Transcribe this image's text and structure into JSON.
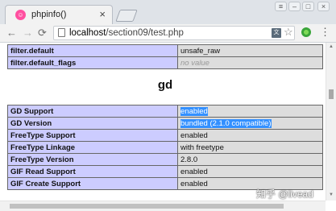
{
  "browser": {
    "tab_title": "phpinfo()",
    "tab_close": "×",
    "favicon_glyph": "☺",
    "window_controls": [
      "≡",
      "–",
      "□",
      "×"
    ],
    "back": "←",
    "forward": "→",
    "reload": "⟳",
    "url_host": "localhost",
    "url_path": "/section09/test.php",
    "translate_glyph": "文",
    "star": "☆",
    "menu": "⋮"
  },
  "page": {
    "top_rows": [
      {
        "directive": "filter.default",
        "value": "unsafe_raw"
      },
      {
        "directive": "filter.default_flags",
        "value": "no value"
      }
    ],
    "section_title": "gd",
    "gd_rows": [
      {
        "directive": "GD Support",
        "value": "enabled"
      },
      {
        "directive": "GD Version",
        "value": "bundled (2.1.0 compatible)"
      },
      {
        "directive": "FreeType Support",
        "value": "enabled"
      },
      {
        "directive": "FreeType Linkage",
        "value": "with freetype"
      },
      {
        "directive": "FreeType Version",
        "value": "2.8.0"
      },
      {
        "directive": "GIF Read Support",
        "value": "enabled"
      },
      {
        "directive": "GIF Create Support",
        "value": "enabled"
      }
    ]
  },
  "watermark": "知乎 @livead",
  "colors": {
    "header_cell": "#ccccff",
    "value_cell": "#dddddd",
    "selection": "#3390ff",
    "favicon": "#ff4fa0"
  }
}
